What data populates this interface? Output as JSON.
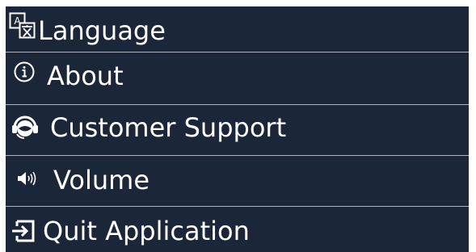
{
  "menu": {
    "background": "#1c2639",
    "divider_color": "#aeb4bf",
    "items": [
      {
        "label": "Language",
        "icon": "language-icon"
      },
      {
        "label": "About",
        "icon": "info-icon"
      },
      {
        "label": "Customer Support",
        "icon": "headset-icon"
      },
      {
        "label": "Volume",
        "icon": "speaker-icon"
      },
      {
        "label": "Quit Application",
        "icon": "exit-icon"
      }
    ]
  }
}
